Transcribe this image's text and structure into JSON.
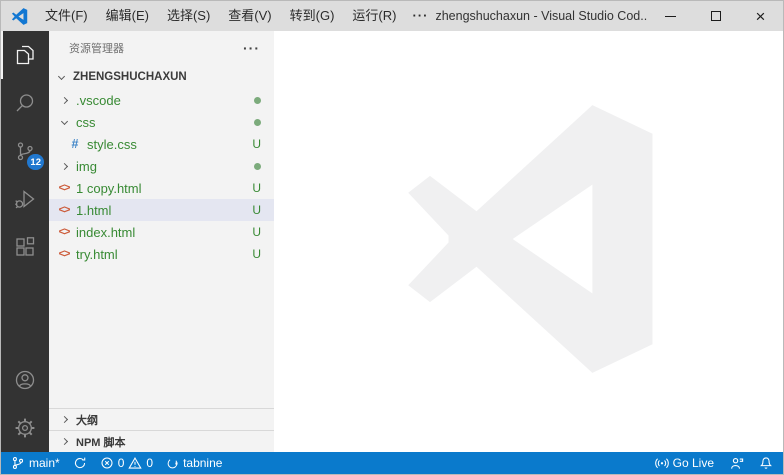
{
  "titlebar": {
    "title": "zhengshuchaxun - Visual Studio Cod...",
    "menus": [
      {
        "label": "文件(F)"
      },
      {
        "label": "编辑(E)"
      },
      {
        "label": "选择(S)"
      },
      {
        "label": "查看(V)"
      },
      {
        "label": "转到(G)"
      },
      {
        "label": "运行(R)"
      },
      {
        "label": "···"
      }
    ]
  },
  "glyphs": {
    "close": "×"
  },
  "activity_bar": {
    "source_control_badge": "12"
  },
  "sidebar": {
    "header": {
      "title": "资源管理器",
      "actions": "···"
    },
    "root": "ZHENGSHUCHAXUN",
    "tree": [
      {
        "name": ".vscode"
      },
      {
        "name": "css"
      },
      {
        "name": "style.css",
        "badge": "U"
      },
      {
        "name": "img"
      },
      {
        "name": "1 copy.html",
        "badge": "U"
      },
      {
        "name": "1.html",
        "badge": "U"
      },
      {
        "name": "index.html",
        "badge": "U"
      },
      {
        "name": "try.html",
        "badge": "U"
      }
    ],
    "sections": [
      {
        "label": "大纲"
      },
      {
        "label": "NPM 脚本"
      }
    ]
  },
  "file_icons": {
    "css": "#",
    "html": "<>"
  },
  "status_bar": {
    "branch": "main*",
    "errors": "0",
    "warnings": "0",
    "tabnine": "tabnine",
    "go_live": "Go Live"
  },
  "colors": {
    "status_accent": "#0a7acc",
    "titlebar_bg": "#dddddd",
    "activity_bar_bg": "#333333",
    "sidebar_bg": "#f3f3f3",
    "selection_bg": "#e4e6f1",
    "untracked_green": "#388a34",
    "html_icon": "#cc5b3a",
    "css_icon": "#3f85c7",
    "badge_blue": "#2178cf",
    "watermark": "#f0f0f1"
  }
}
